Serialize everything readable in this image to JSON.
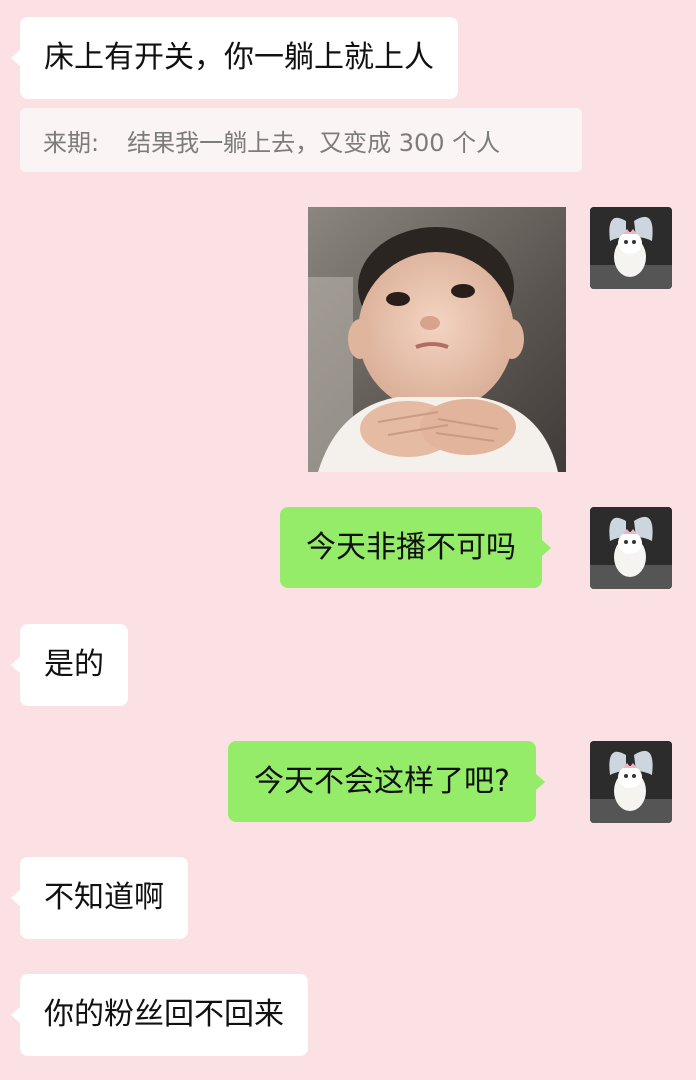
{
  "theme": {
    "background": "#fce1e4",
    "incoming_bubble": "#ffffff",
    "outgoing_bubble": "#95ec69",
    "quote_background": "#fbf4f5"
  },
  "messages": [
    {
      "side": "incoming",
      "type": "text",
      "text": "床上有开关，你一躺上就上人"
    },
    {
      "side": "incoming",
      "type": "quote",
      "sender": "来期:",
      "text": "结果我一躺上去，又变成 300 个人"
    },
    {
      "side": "outgoing",
      "type": "sticker",
      "icon": "baby-sticker-image"
    },
    {
      "side": "outgoing",
      "type": "text",
      "text": "今天非播不可吗"
    },
    {
      "side": "incoming",
      "type": "text",
      "text": "是的"
    },
    {
      "side": "outgoing",
      "type": "text",
      "text": "今天不会这样了吧?"
    },
    {
      "side": "incoming",
      "type": "text",
      "text": "不知道啊"
    },
    {
      "side": "incoming",
      "type": "text",
      "text": "你的粉丝回不回来"
    }
  ],
  "avatar": {
    "icon": "white-cat-butterfly-avatar"
  }
}
